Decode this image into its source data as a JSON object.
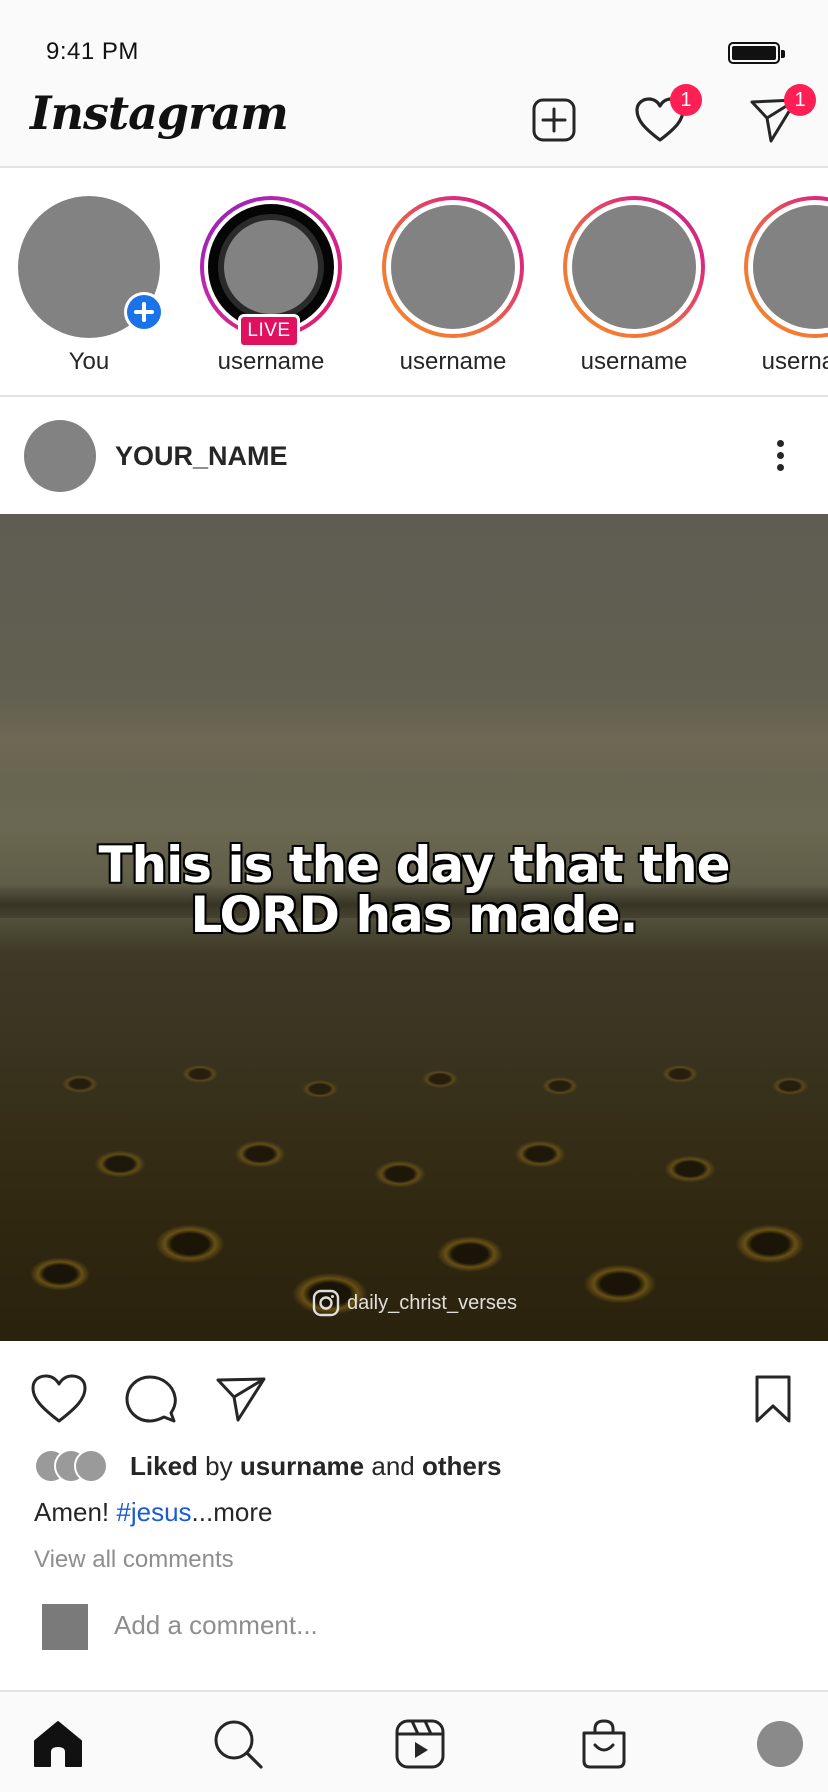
{
  "status_bar": {
    "time": "9:41 PM"
  },
  "header": {
    "logo": "Instagram",
    "activity_badge": "1",
    "messages_badge": "1"
  },
  "stories": [
    {
      "label": "You",
      "kind": "own"
    },
    {
      "label": "username",
      "kind": "live",
      "live_label": "LIVE"
    },
    {
      "label": "username",
      "kind": "story"
    },
    {
      "label": "username",
      "kind": "story"
    },
    {
      "label": "username",
      "kind": "story"
    }
  ],
  "post": {
    "username": "YOUR_NAME",
    "image_text_line1": "This is the day that the",
    "image_text_line2": "LORD has made.",
    "watermark": "daily_christ_verses",
    "likes": {
      "liked": "Liked",
      "by": "by",
      "user": "usurname",
      "and": "and",
      "others": "others"
    },
    "caption": {
      "text": "Amen!",
      "hashtag": "#jesus",
      "more": "...more"
    },
    "view_comments": "View all comments",
    "comment_placeholder": "Add a comment..."
  },
  "colors": {
    "badge": "#ff1f54",
    "live": "#e0115f",
    "hashtag": "#1a5bd6",
    "add_story": "#1a73e8"
  },
  "icons": {
    "header": [
      "new-post-icon",
      "heart-icon",
      "direct-message-icon"
    ],
    "actions": [
      "like-icon",
      "comment-icon",
      "share-icon",
      "bookmark-icon"
    ],
    "tabs": [
      "home-icon",
      "search-icon",
      "reels-icon",
      "shop-icon",
      "profile-avatar"
    ]
  }
}
